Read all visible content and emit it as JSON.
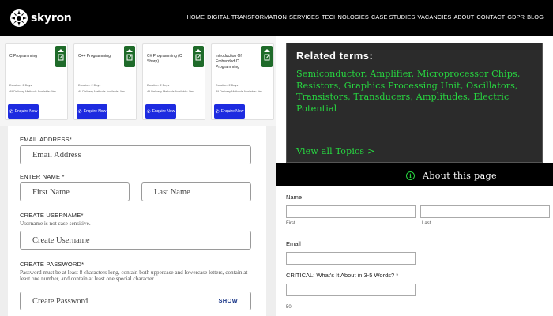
{
  "header": {
    "logo_text": "skyron",
    "nav": [
      "HOME",
      "DIGITAL TRANSFORMATION",
      "SERVICES",
      "TECHNOLOGIES",
      "CASE STUDIES",
      "VACANCIES",
      "ABOUT",
      "CONTACT",
      "GDPR",
      "BLOG"
    ]
  },
  "cards": [
    {
      "title": "C Programming",
      "duration": "Duration: 2 Days",
      "delivery": "All Delivery Methods Available: Yes",
      "button": "Enquire Now"
    },
    {
      "title": "C++ Programming",
      "duration": "Duration: 2 Days",
      "delivery": "All Delivery Methods Available: Yes",
      "button": "Enquire Now"
    },
    {
      "title": "C# Programming (C Sharp)",
      "duration": "Duration: 2 Days",
      "delivery": "All Delivery Methods Available: Yes",
      "button": "Enquire Now"
    },
    {
      "title": "Introduction Of Embedded C Programming",
      "duration": "Duration: 2 Days",
      "delivery": "All Delivery Methods Available: Yes",
      "button": "Enquire Now"
    }
  ],
  "form": {
    "email_label": "EMAIL ADDRESS*",
    "email_placeholder": "Email Address",
    "name_label": "ENTER NAME *",
    "first_placeholder": "First Name",
    "last_placeholder": "Last Name",
    "username_label": "CREATE USERNAME*",
    "username_help": "Username is not case sensitive.",
    "username_placeholder": "Create Username",
    "password_label": "CREATE PASSWORD*",
    "password_help": "Password must be at least 8 characters long, contain both uppercase and lowercase letters, contain at least one number, and contain at least one special character.",
    "password_placeholder": "Create Password",
    "show_label": "SHOW"
  },
  "related": {
    "title": "Related terms:",
    "terms": "Semiconductor, Amplifier, Microprocessor Chips, Resistors, Graphics Processing Unit, Oscillators, Transistors, Transducers, Amplitudes, Electric Potential",
    "view_all": "View all Topics  >"
  },
  "about": {
    "icon_glyph": "i",
    "label": "About this page"
  },
  "rform": {
    "name_label": "Name",
    "first_sub": "First",
    "last_sub": "Last",
    "email_label": "Email",
    "critical_label": "CRITICAL: What's It About in 3-5 Words? *",
    "count": "50"
  },
  "colors": {
    "accent_green": "#27d640",
    "button_blue": "#1d2be0",
    "tag_green": "#1f6b2a",
    "show_blue": "#1e3a8a"
  }
}
